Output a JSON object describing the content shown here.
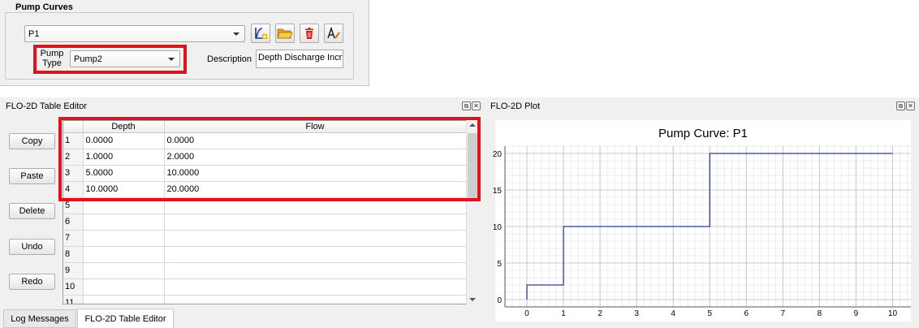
{
  "pump_curves": {
    "title": "Pump Curves",
    "curve_selected": "P1",
    "pump_type_label": "Pump Type",
    "pump_type_value": "Pump2",
    "description_label": "Description",
    "description_value": "Depth Discharge Incr",
    "toolbar_icons": [
      "add-curve-icon",
      "folder-open-icon",
      "delete-icon",
      "rename-icon"
    ]
  },
  "table_editor": {
    "title": "FLO-2D Table Editor",
    "buttons": [
      "Copy",
      "Paste",
      "Delete",
      "Undo",
      "Redo"
    ],
    "columns": [
      "Depth",
      "Flow"
    ],
    "rows": [
      {
        "n": "1",
        "depth": "0.0000",
        "flow": "0.0000"
      },
      {
        "n": "2",
        "depth": "1.0000",
        "flow": "2.0000"
      },
      {
        "n": "3",
        "depth": "5.0000",
        "flow": "10.0000"
      },
      {
        "n": "4",
        "depth": "10.0000",
        "flow": "20.0000"
      },
      {
        "n": "5",
        "depth": "",
        "flow": ""
      },
      {
        "n": "6",
        "depth": "",
        "flow": ""
      },
      {
        "n": "7",
        "depth": "",
        "flow": ""
      },
      {
        "n": "8",
        "depth": "",
        "flow": ""
      },
      {
        "n": "9",
        "depth": "",
        "flow": ""
      },
      {
        "n": "10",
        "depth": "",
        "flow": ""
      },
      {
        "n": "11",
        "depth": "",
        "flow": ""
      }
    ]
  },
  "tabs": [
    "Log Messages",
    "FLO-2D Table Editor"
  ],
  "plot": {
    "dock_title": "FLO-2D Plot",
    "line_color": "#2b3a98",
    "highlight_color": "#e2111f"
  },
  "chart_data": {
    "type": "line",
    "title": "Pump Curve: P1",
    "step": true,
    "x": [
      0,
      1,
      5,
      10
    ],
    "y": [
      2,
      10,
      20,
      20
    ],
    "xlim": [
      -0.6,
      10.5
    ],
    "ylim": [
      -1,
      21
    ],
    "xticks": [
      0,
      1,
      2,
      3,
      4,
      5,
      6,
      7,
      8,
      9,
      10
    ],
    "yticks": [
      0,
      5,
      10,
      15,
      20
    ],
    "grid": true
  }
}
